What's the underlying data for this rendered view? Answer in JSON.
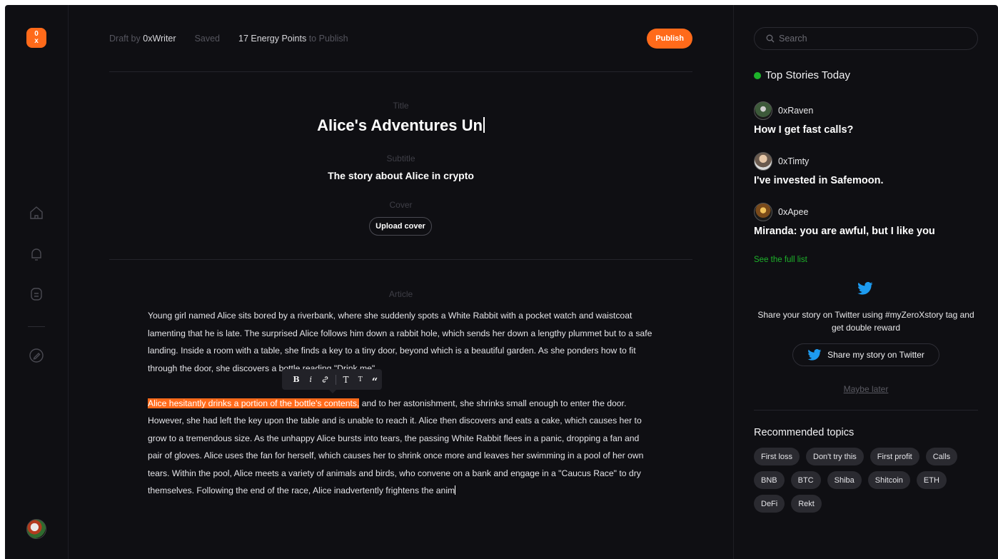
{
  "logo": {
    "text": "0x"
  },
  "topbar": {
    "draft_prefix": "Draft by",
    "author": "0xWriter",
    "saved": "Saved",
    "energy_points": "17 Energy Points",
    "energy_suffix": "to Publish",
    "publish_label": "Publish"
  },
  "editor": {
    "title_label": "Title",
    "title_value": "Alice's Adventures Un",
    "subtitle_label": "Subtitle",
    "subtitle_value": "The story about Alice in crypto",
    "cover_label": "Cover",
    "upload_label": "Upload cover",
    "article_label": "Article",
    "paragraph1": "Young girl named Alice sits bored by a riverbank, where she suddenly spots a White Rabbit with a pocket watch and waistcoat lamenting that he is late. The surprised Alice follows him down a rabbit hole, which sends her down a lengthy plummet but to a safe landing. Inside a room with a table, she finds a key to a tiny door, beyond which is a beautiful garden. As she ponders how to fit through the door, she discovers a bottle reading \"Drink me\".",
    "paragraph2_highlight": "Alice hesitantly drinks a portion of the bottle's contents,",
    "paragraph2_rest": " and to her astonishment, she shrinks small enough to enter the door. However, she had left the key upon the table and is unable to reach it. Alice then discovers and eats a cake, which causes her to grow to a tremendous size. As the unhappy Alice bursts into tears, the passing White Rabbit flees in a panic, dropping a fan and pair of gloves. Alice uses the fan for herself, which causes her to shrink once more and leaves her swimming in a pool of her own tears. Within the pool, Alice meets a variety of animals and birds, who convene on a bank and engage in a \"Caucus Race\" to dry themselves. Following the end of the race, Alice inadvertently frightens the anim",
    "format_toolbar": {
      "bold": "B",
      "italic": "i",
      "heading_large": "T",
      "heading_small": "T",
      "quote": "“"
    }
  },
  "sidebar": {
    "search_placeholder": "Search",
    "top_stories_title": "Top Stories Today",
    "stories": [
      {
        "author": "0xRaven",
        "headline": "How I get fast calls?"
      },
      {
        "author": "0xTimty",
        "headline": "I've invested in Safemoon."
      },
      {
        "author": "0xApee",
        "headline": "Miranda: you are awful, but I like you"
      }
    ],
    "full_list_label": "See the full list",
    "share_text": "Share your story on Twitter using #myZeroXstory tag and get double reward",
    "share_button_label": "Share my story on Twitter",
    "maybe_later": "Maybe later",
    "recommended_title": "Recommended topics",
    "topics": [
      "First loss",
      "Don't try this",
      "First profit",
      "Calls",
      "BNB",
      "BTC",
      "Shiba",
      "Shitcoin",
      "ETH",
      "DeFi",
      "Rekt"
    ]
  },
  "colors": {
    "accent": "#ff6a1a",
    "live": "#1db32a",
    "twitter": "#1d9bf0",
    "background": "#0f0f13"
  }
}
